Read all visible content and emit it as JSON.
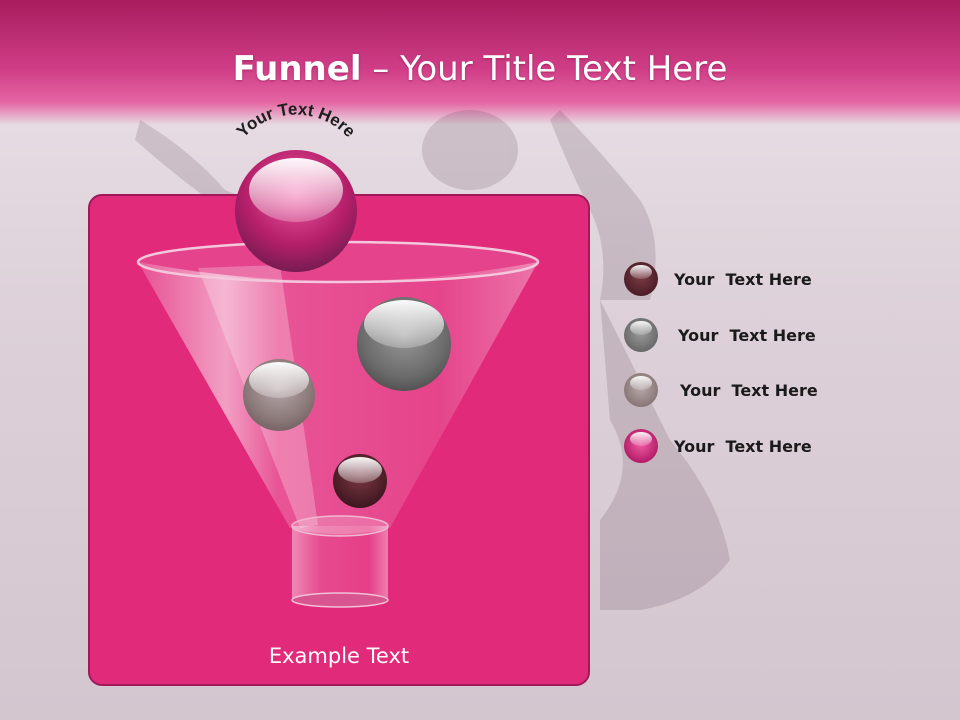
{
  "title": {
    "strong": "Funnel",
    "rest": " – Your Title Text Here"
  },
  "funnel": {
    "top_label": "Your Text Here",
    "footer_text": "Example Text"
  },
  "legend": [
    {
      "label": "Your  Text Here",
      "color": "#5a2530"
    },
    {
      "label": "Your  Text Here",
      "color": "#6e6e6e"
    },
    {
      "label": "Your  Text Here",
      "color": "#8a7a78"
    },
    {
      "label": "Your  Text Here",
      "color": "#b2246e"
    }
  ],
  "colors": {
    "panel": "#e22a7b",
    "header": "#c32f74",
    "accent_ball": "#b2246e"
  }
}
